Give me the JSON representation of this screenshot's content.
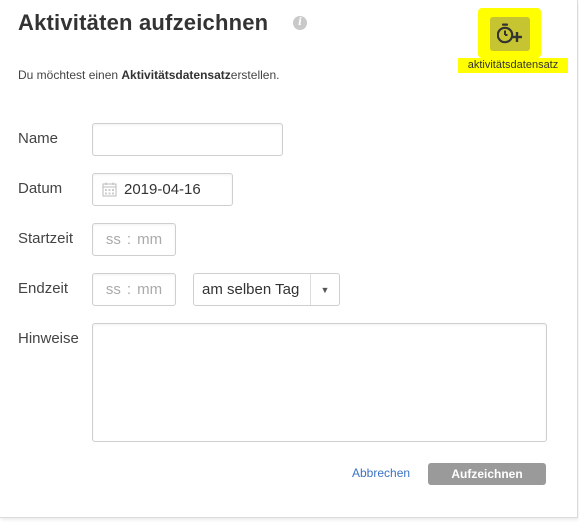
{
  "dialog": {
    "title": "Aktivitäten aufzeichnen",
    "info_icon": "i",
    "subtitle_prefix": "Du möchtest einen ",
    "subtitle_bold": "Aktivitätsdatensatz",
    "subtitle_suffix": "erstellen."
  },
  "activity_button": {
    "icon": "stopwatch-plus-icon",
    "label": "aktivitätsdatensatz",
    "highlight_color": "#ffff00"
  },
  "form": {
    "name_label": "Name",
    "name_value": "",
    "date_label": "Datum",
    "date_value": "2019-04-16",
    "start_label": "Startzeit",
    "start_hours_placeholder": "ss",
    "start_minutes_placeholder": "mm",
    "time_separator": ":",
    "end_label": "Endzeit",
    "end_hours_placeholder": "ss",
    "end_minutes_placeholder": "mm",
    "end_day_select": "am selben Tag",
    "notes_label": "Hinweise",
    "notes_value": ""
  },
  "actions": {
    "cancel_label": "Abbrechen",
    "submit_label": "Aufzeichnen",
    "link_color": "#3b73c4",
    "submit_color": "#9a9a9a"
  }
}
